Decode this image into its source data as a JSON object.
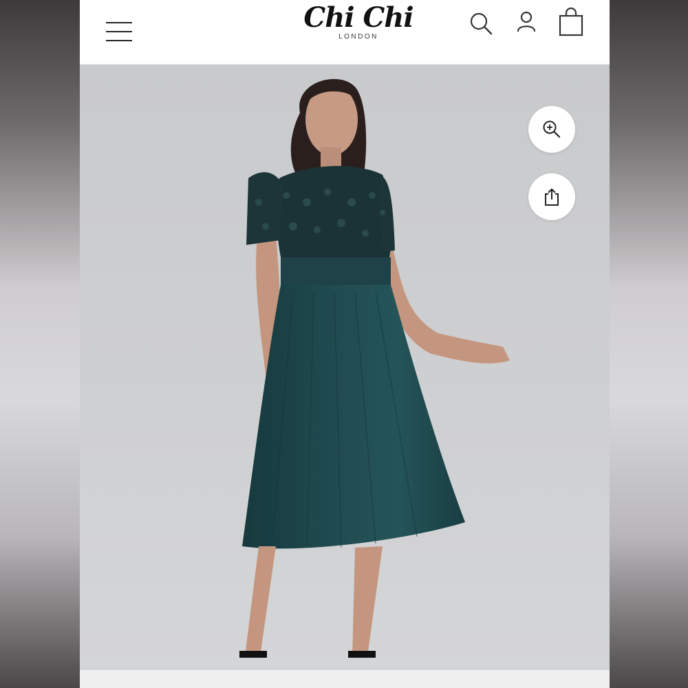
{
  "header": {
    "brand_name": "Chi Chi",
    "brand_location": "LONDON",
    "menu_icon": "hamburger-menu-icon",
    "search_icon": "search-icon",
    "account_icon": "user-icon",
    "bag_icon": "shopping-bag-icon"
  },
  "product_image": {
    "zoom_icon": "zoom-in-icon",
    "share_icon": "share-icon",
    "dress_color": "#1e4a4f",
    "background_color": "#cdced0"
  }
}
